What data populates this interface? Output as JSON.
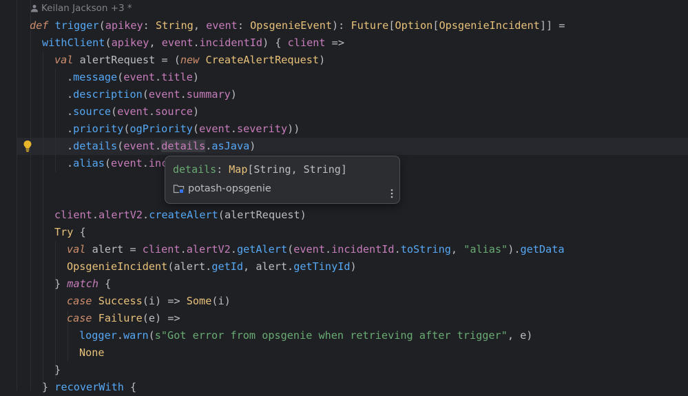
{
  "blame": {
    "author": "Keilan Jackson +3 *"
  },
  "code_lines": [
    {
      "id": "l1",
      "tokens": [
        [
          "def",
          "t-kw"
        ],
        [
          " "
        ],
        [
          "trigger",
          "t-fn"
        ],
        [
          "("
        ],
        [
          "apikey",
          "t-param"
        ],
        [
          ": "
        ],
        [
          "String",
          "t-type"
        ],
        [
          ", "
        ],
        [
          "event",
          "t-param"
        ],
        [
          ": "
        ],
        [
          "OpsgenieEvent",
          "t-type"
        ],
        [
          "): "
        ],
        [
          "Future",
          "t-type"
        ],
        [
          "["
        ],
        [
          "Option",
          "t-type"
        ],
        [
          "["
        ],
        [
          "OpsgenieIncident",
          "t-type"
        ],
        [
          "]] ="
        ]
      ]
    },
    {
      "id": "l2",
      "tokens": [
        [
          "withClient",
          "t-fn"
        ],
        [
          "("
        ],
        [
          "apikey",
          "t-param"
        ],
        [
          ", "
        ],
        [
          "event",
          "t-param"
        ],
        [
          "."
        ],
        [
          "incidentId",
          "t-field"
        ],
        [
          ") { "
        ],
        [
          "client",
          "t-param"
        ],
        [
          " =>"
        ]
      ]
    },
    {
      "id": "l3",
      "tokens": [
        [
          "val",
          "t-kw"
        ],
        [
          " alertRequest = ("
        ],
        [
          "new",
          "t-kw"
        ],
        [
          " "
        ],
        [
          "CreateAlertRequest",
          "t-type"
        ],
        [
          ")"
        ]
      ]
    },
    {
      "id": "l4",
      "tokens": [
        [
          "."
        ],
        [
          "message",
          "t-fn"
        ],
        [
          "("
        ],
        [
          "event",
          "t-param"
        ],
        [
          "."
        ],
        [
          "title",
          "t-field"
        ],
        [
          ")"
        ]
      ]
    },
    {
      "id": "l5",
      "tokens": [
        [
          "."
        ],
        [
          "description",
          "t-fn"
        ],
        [
          "("
        ],
        [
          "event",
          "t-param"
        ],
        [
          "."
        ],
        [
          "summary",
          "t-field"
        ],
        [
          ")"
        ]
      ]
    },
    {
      "id": "l6",
      "tokens": [
        [
          "."
        ],
        [
          "source",
          "t-fn"
        ],
        [
          "("
        ],
        [
          "event",
          "t-param"
        ],
        [
          "."
        ],
        [
          "source",
          "t-field"
        ],
        [
          ")"
        ]
      ]
    },
    {
      "id": "l7",
      "tokens": [
        [
          "."
        ],
        [
          "priority",
          "t-fn"
        ],
        [
          "("
        ],
        [
          "ogPriority",
          "t-fn"
        ],
        [
          "("
        ],
        [
          "event",
          "t-param"
        ],
        [
          "."
        ],
        [
          "severity",
          "t-field"
        ],
        [
          "))"
        ]
      ]
    },
    {
      "id": "l8",
      "tokens": [
        [
          "."
        ],
        [
          "details",
          "t-fn"
        ],
        [
          "("
        ],
        [
          "event",
          "t-param"
        ],
        [
          "."
        ],
        [
          "details",
          "t-sel"
        ],
        [
          "."
        ],
        [
          "asJava",
          "t-fn"
        ],
        [
          ")"
        ]
      ]
    },
    {
      "id": "l9",
      "tokens": [
        [
          "."
        ],
        [
          "alias",
          "t-fn"
        ],
        [
          "("
        ],
        [
          "event",
          "t-param"
        ],
        [
          "."
        ],
        [
          "inc",
          "t-field"
        ]
      ]
    },
    {
      "id": "l10",
      "tokens": [
        [
          "client",
          "t-param"
        ],
        [
          "."
        ],
        [
          "alertV2",
          "t-field"
        ],
        [
          "."
        ],
        [
          "createAlert",
          "t-fn"
        ],
        [
          "(alertRequest)"
        ]
      ]
    },
    {
      "id": "l11",
      "tokens": [
        [
          "Try",
          "t-type"
        ],
        [
          " {"
        ]
      ]
    },
    {
      "id": "l12",
      "tokens": [
        [
          "val",
          "t-kw"
        ],
        [
          " alert = "
        ],
        [
          "client",
          "t-param"
        ],
        [
          "."
        ],
        [
          "alertV2",
          "t-field"
        ],
        [
          "."
        ],
        [
          "getAlert",
          "t-fn"
        ],
        [
          "("
        ],
        [
          "event",
          "t-param"
        ],
        [
          "."
        ],
        [
          "incidentId",
          "t-field"
        ],
        [
          "."
        ],
        [
          "toString",
          "t-fn"
        ],
        [
          ", "
        ],
        [
          "\"alias\"",
          "t-str"
        ],
        [
          ")."
        ],
        [
          "getData",
          "t-fn"
        ]
      ]
    },
    {
      "id": "l13",
      "tokens": [
        [
          "OpsgenieIncident",
          "t-type"
        ],
        [
          "(alert."
        ],
        [
          "getId",
          "t-fn"
        ],
        [
          ", alert."
        ],
        [
          "getTinyId",
          "t-fn"
        ],
        [
          ")"
        ]
      ]
    },
    {
      "id": "l14",
      "tokens": [
        [
          "} "
        ],
        [
          "match",
          "t-match"
        ],
        [
          " {"
        ]
      ]
    },
    {
      "id": "l15",
      "tokens": [
        [
          "case",
          "t-kw"
        ],
        [
          " "
        ],
        [
          "Success",
          "t-type"
        ],
        [
          "(i) => "
        ],
        [
          "Some",
          "t-type"
        ],
        [
          "(i)"
        ]
      ]
    },
    {
      "id": "l16",
      "tokens": [
        [
          "case",
          "t-kw"
        ],
        [
          " "
        ],
        [
          "Failure",
          "t-type"
        ],
        [
          "(e) =>"
        ]
      ]
    },
    {
      "id": "l17",
      "tokens": [
        [
          "logger",
          "t-fn"
        ],
        [
          "."
        ],
        [
          "warn",
          "t-fn"
        ],
        [
          "("
        ],
        [
          "s\"Got error from opsgenie when retrieving after trigger\"",
          "t-str"
        ],
        [
          ", e)"
        ]
      ]
    },
    {
      "id": "l18",
      "tokens": [
        [
          "None",
          "t-none"
        ]
      ]
    },
    {
      "id": "l19",
      "tokens": [
        [
          "}"
        ]
      ]
    },
    {
      "id": "l20",
      "tokens": [
        [
          "} "
        ],
        [
          "recoverWith",
          "t-fn"
        ],
        [
          " {"
        ]
      ]
    }
  ],
  "popup": {
    "name": "details",
    "sep": ": ",
    "type": "Map",
    "generics": "[String, String]",
    "module": "potash-opsgenie"
  },
  "icons": {
    "author": "person-icon",
    "intention": "lightbulb-icon",
    "module": "folder-icon",
    "more": "more-vertical-icon"
  }
}
